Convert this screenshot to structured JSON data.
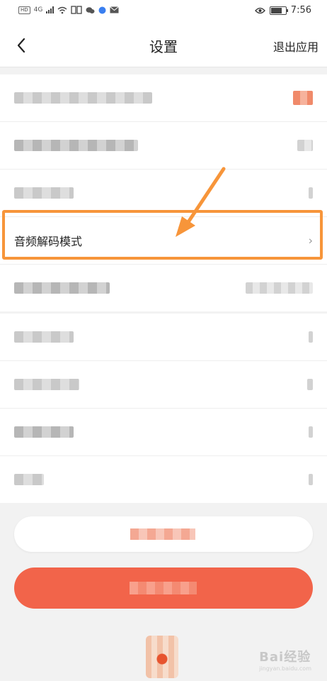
{
  "status_bar": {
    "network": "4G",
    "time": "7:56"
  },
  "header": {
    "title": "设置",
    "exit_label": "退出应用"
  },
  "settings_highlighted": {
    "label": "音频解码模式",
    "chevron": "›"
  },
  "watermark": {
    "text": "Bai经验",
    "sub": "jingyan.baidu.com"
  },
  "annotation": {
    "color": "#f7953a"
  },
  "colors": {
    "primary_button": "#f2644a"
  }
}
